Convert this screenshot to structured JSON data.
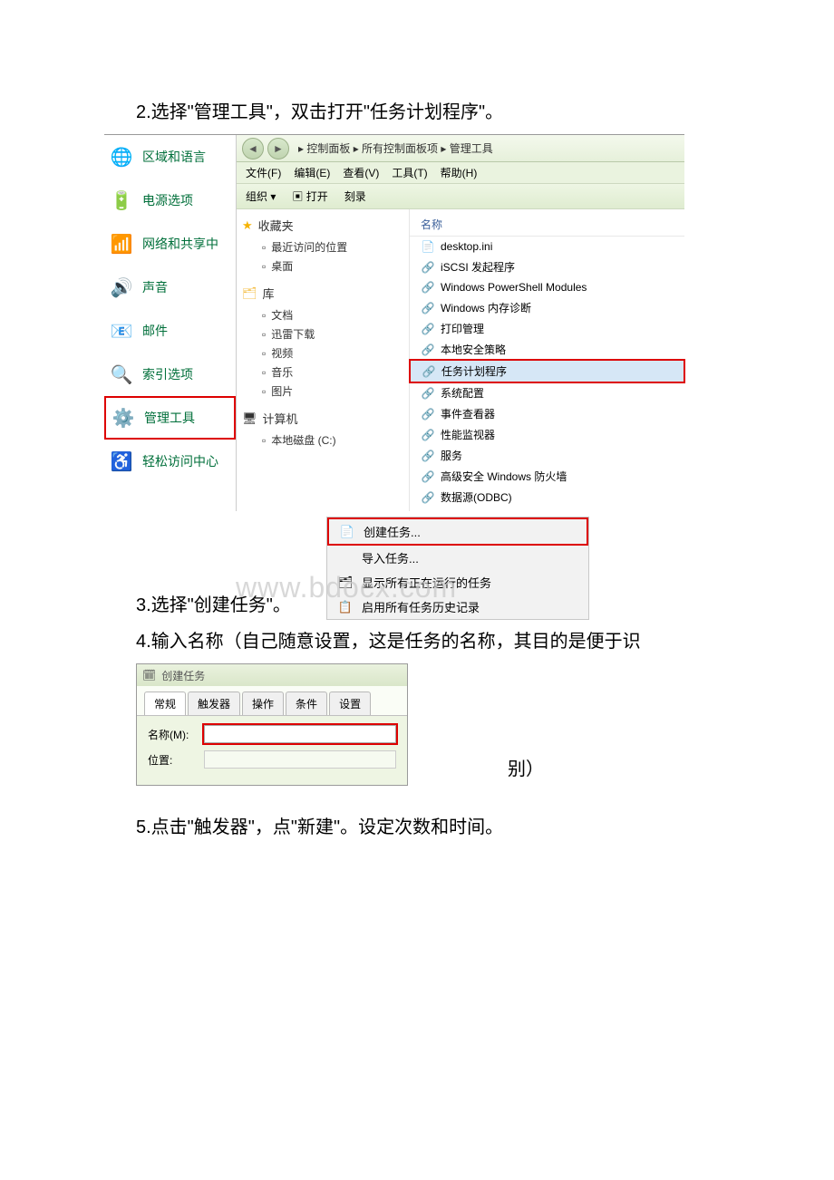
{
  "steps": {
    "s2": "2.选择\"管理工具\"，双击打开\"任务计划程序\"。",
    "s3": "3.选择\"创建任务\"。",
    "s4": "4.输入名称（自己随意设置，这是任务的名称，其目的是便于识",
    "s4_suffix": "别）",
    "s5": "5.点击\"触发器\"，点\"新建\"。设定次数和时间。"
  },
  "control_panel": {
    "left": [
      {
        "icon": "🌐",
        "label": "区域和语言"
      },
      {
        "icon": "🔋",
        "label": "电源选项"
      },
      {
        "icon": "📶",
        "label": "网络和共享中"
      },
      {
        "icon": "🔊",
        "label": "声音"
      },
      {
        "icon": "📧",
        "label": "邮件"
      },
      {
        "icon": "🔍",
        "label": "索引选项"
      },
      {
        "icon": "⚙️",
        "label": "管理工具",
        "hl": true
      },
      {
        "icon": "♿",
        "label": "轻松访问中心"
      }
    ],
    "breadcrumb": "▸ 控制面板 ▸ 所有控制面板项 ▸ 管理工具",
    "menus": [
      "文件(F)",
      "编辑(E)",
      "查看(V)",
      "工具(T)",
      "帮助(H)"
    ],
    "toolbar": [
      "组织 ▾",
      "▣ 打开",
      "刻录"
    ],
    "nav": {
      "fav": {
        "title": "收藏夹",
        "items": [
          "最近访问的位置",
          "桌面"
        ]
      },
      "lib": {
        "title": "库",
        "items": [
          "文档",
          "迅雷下载",
          "视频",
          "音乐",
          "图片"
        ]
      },
      "comp": {
        "title": "计算机",
        "items": [
          "本地磁盘 (C:)"
        ]
      }
    },
    "list_header": "名称",
    "files": [
      {
        "icon": "📄",
        "name": "desktop.ini"
      },
      {
        "icon": "🔗",
        "name": "iSCSI 发起程序"
      },
      {
        "icon": "🔗",
        "name": "Windows PowerShell Modules"
      },
      {
        "icon": "🔗",
        "name": "Windows 内存诊断"
      },
      {
        "icon": "🔗",
        "name": "打印管理"
      },
      {
        "icon": "🔗",
        "name": "本地安全策略"
      },
      {
        "icon": "🔗",
        "name": "任务计划程序",
        "sel": true,
        "hl": true
      },
      {
        "icon": "🔗",
        "name": "系统配置"
      },
      {
        "icon": "🔗",
        "name": "事件查看器"
      },
      {
        "icon": "🔗",
        "name": "性能监视器"
      },
      {
        "icon": "🔗",
        "name": "服务"
      },
      {
        "icon": "🔗",
        "name": "高级安全 Windows 防火墙"
      },
      {
        "icon": "🔗",
        "name": "数据源(ODBC)"
      }
    ]
  },
  "context_menu": [
    {
      "icon": "📄",
      "label": "创建任务...",
      "hl": true
    },
    {
      "icon": "",
      "label": "导入任务..."
    },
    {
      "icon": "🗂",
      "label": "显示所有正在运行的任务"
    },
    {
      "icon": "📋",
      "label": "启用所有任务历史记录"
    }
  ],
  "watermark": "www.bdocx.com",
  "create_task": {
    "title": "创建任务",
    "tabs": [
      "常规",
      "触发器",
      "操作",
      "条件",
      "设置"
    ],
    "name_label": "名称(M):",
    "location_label": "位置:"
  }
}
